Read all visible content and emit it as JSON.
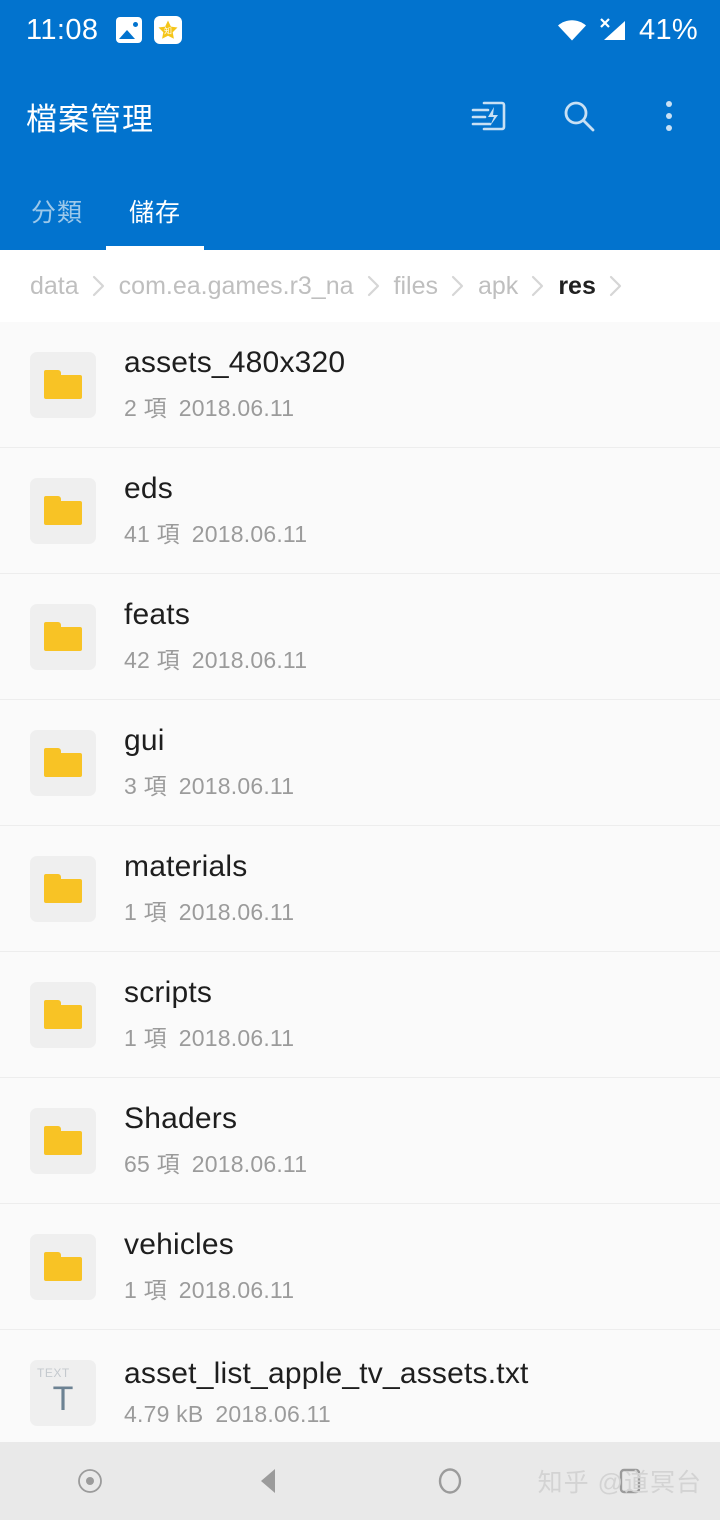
{
  "status_bar": {
    "time": "11:08",
    "battery": "41%",
    "icons": [
      "photo-icon",
      "star-icon",
      "wifi-icon",
      "signal-off-icon"
    ]
  },
  "app_bar": {
    "title": "檔案管理",
    "actions": [
      "transfer-icon",
      "search-icon",
      "overflow-menu-icon"
    ]
  },
  "tabs": [
    {
      "label": "分類",
      "active": false
    },
    {
      "label": "儲存",
      "active": true
    }
  ],
  "breadcrumb": {
    "separator": "›",
    "items": [
      {
        "label": "data",
        "current": false
      },
      {
        "label": "com.ea.games.r3_na",
        "current": false
      },
      {
        "label": "files",
        "current": false
      },
      {
        "label": "apk",
        "current": false
      },
      {
        "label": "res",
        "current": true
      }
    ]
  },
  "file_list": [
    {
      "name": "assets_480x320",
      "count": "2 項",
      "date": "2018.06.11",
      "type": "folder"
    },
    {
      "name": "eds",
      "count": "41 項",
      "date": "2018.06.11",
      "type": "folder"
    },
    {
      "name": "feats",
      "count": "42 項",
      "date": "2018.06.11",
      "type": "folder"
    },
    {
      "name": "gui",
      "count": "3 項",
      "date": "2018.06.11",
      "type": "folder"
    },
    {
      "name": "materials",
      "count": "1 項",
      "date": "2018.06.11",
      "type": "folder"
    },
    {
      "name": "scripts",
      "count": "1 項",
      "date": "2018.06.11",
      "type": "folder"
    },
    {
      "name": "Shaders",
      "count": "65 項",
      "date": "2018.06.11",
      "type": "folder"
    },
    {
      "name": "vehicles",
      "count": "1 項",
      "date": "2018.06.11",
      "type": "folder"
    },
    {
      "name": "asset_list_apple_tv_assets.txt",
      "count": "4.79 kB",
      "date": "2018.06.11",
      "type": "text",
      "icon_label": "TEXT",
      "icon_glyph": "T"
    }
  ],
  "nav_bar": {
    "buttons": [
      "assistant-dot-icon",
      "back-icon",
      "home-icon",
      "recents-icon"
    ],
    "watermark": "知乎 @道冥台"
  },
  "colors": {
    "primary": "#0273CE",
    "folder": "#F8C325",
    "list_bg": "#FAFAFA",
    "nav_bg": "#E9E9E9",
    "text_icon": "#6C8293"
  }
}
